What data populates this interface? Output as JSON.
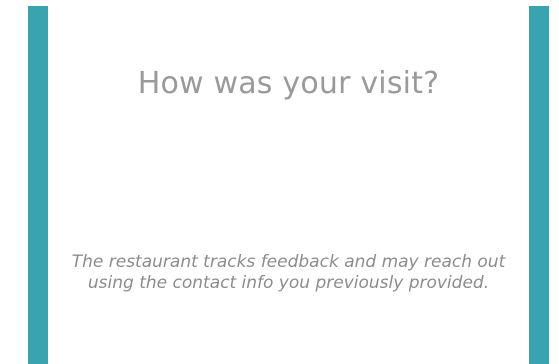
{
  "feedback_card": {
    "title": "How was your visit?",
    "notice": "The restaurant tracks feedback and may reach out using the contact info you previously provided."
  },
  "colors": {
    "side_bar": "#3aa3b0",
    "background": "#ffffff",
    "text": "#9a9a9a"
  }
}
